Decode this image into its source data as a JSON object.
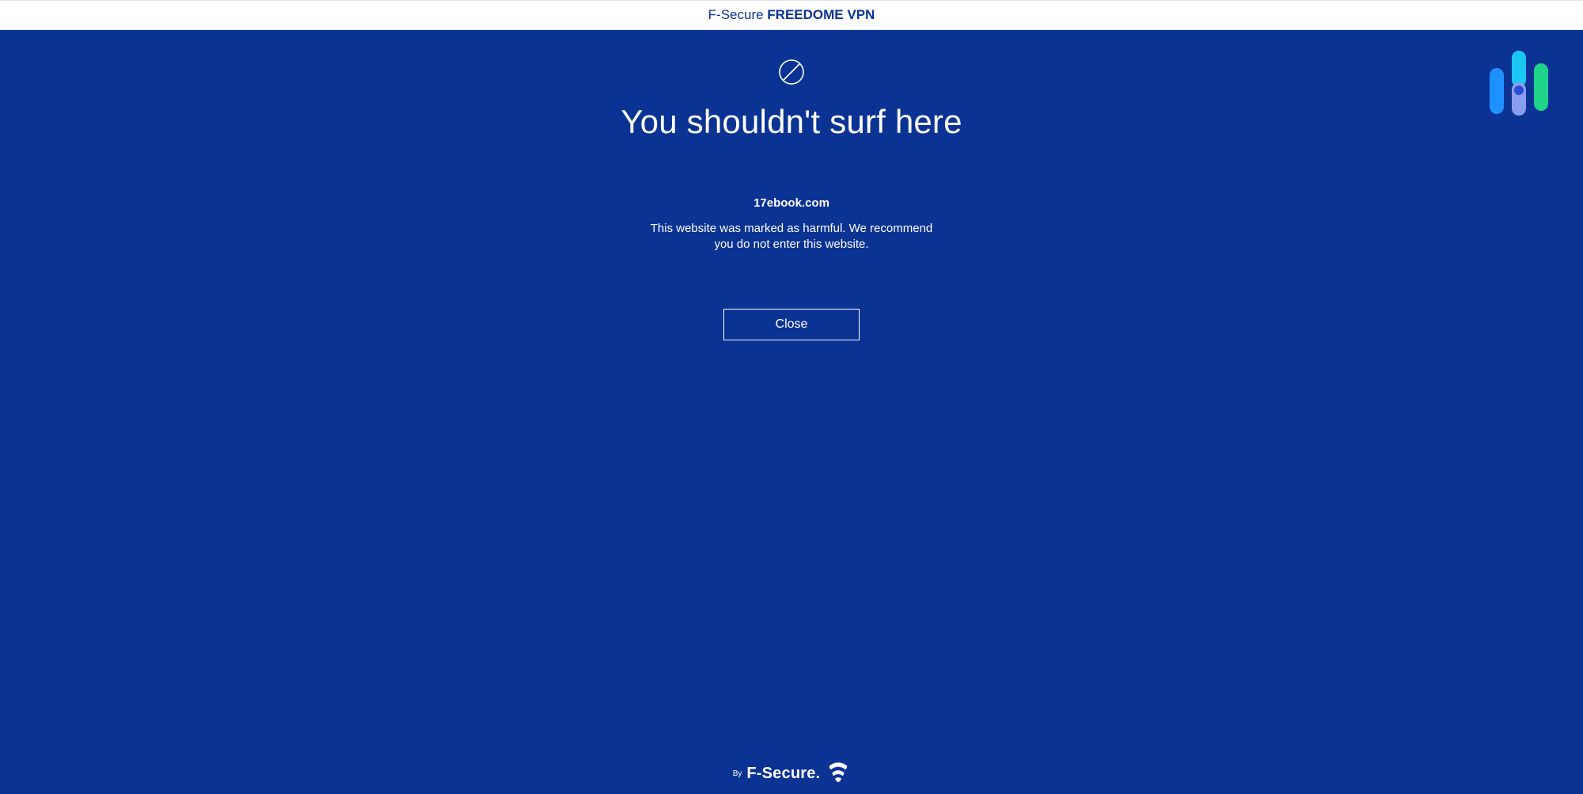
{
  "header": {
    "brand_prefix": "F-Secure ",
    "brand_product": "FREEDOME VPN"
  },
  "warning": {
    "icon_name": "prohibited-icon",
    "heading": "You shouldn't surf here",
    "blocked_domain": "17ebook.com",
    "explanation": "This website was marked as harmful. We recommend you do not enter this website.",
    "close_label": "Close"
  },
  "footer": {
    "by_label": "By",
    "brand": "F-Secure."
  },
  "colors": {
    "bg": "#0b3393",
    "accent_blue": "#1e90ff",
    "accent_cyan": "#19c7f0",
    "accent_green": "#1fd38a",
    "accent_violet": "#8b9df0"
  }
}
